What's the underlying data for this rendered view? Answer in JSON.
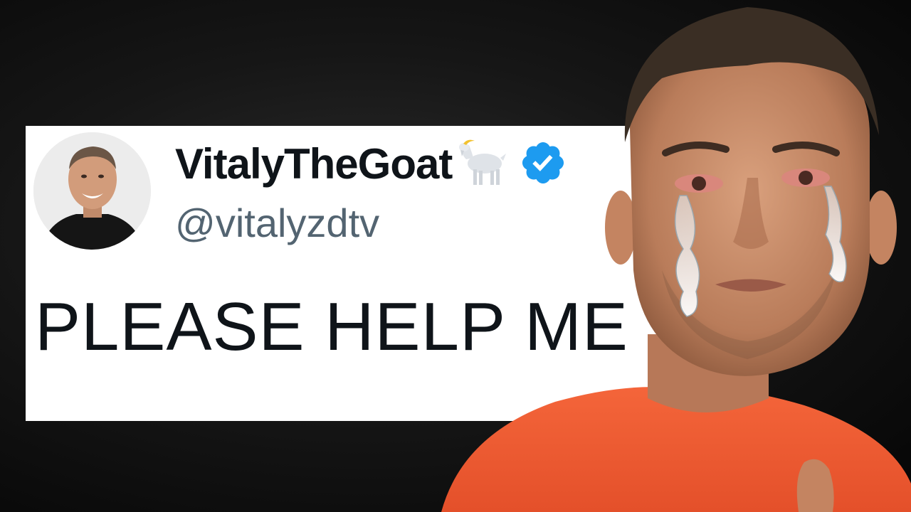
{
  "tweet": {
    "display_name": "VitalyTheGoat",
    "handle": "@vitalyzdtv",
    "text": "PLEASE HELP ME",
    "icons": {
      "emoji": "goat-icon",
      "badge": "verified-badge-icon"
    }
  },
  "colors": {
    "background": "#0a0a0a",
    "card": "#ffffff",
    "name_text": "#0f1419",
    "handle_text": "#536471",
    "verified_blue": "#1d9bf0",
    "shirt": "#f0582f"
  }
}
